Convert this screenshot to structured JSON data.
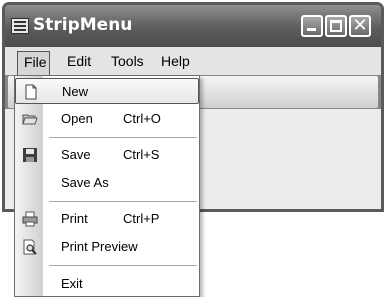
{
  "window": {
    "title": "StripMenu",
    "close_glyph": "✕"
  },
  "menubar": {
    "items": [
      {
        "label": "File"
      },
      {
        "label": "Edit"
      },
      {
        "label": "Tools"
      },
      {
        "label": "Help"
      }
    ]
  },
  "file_menu": {
    "items": [
      {
        "label": "New",
        "shortcut": "",
        "icon": "new-document-icon",
        "selected": true
      },
      {
        "label": "Open",
        "shortcut": "Ctrl+O",
        "icon": "open-folder-icon"
      },
      {
        "label": "Save",
        "shortcut": "Ctrl+S",
        "icon": "floppy-disk-icon"
      },
      {
        "label": "Save As",
        "shortcut": "",
        "icon": ""
      },
      {
        "label": "Print",
        "shortcut": "Ctrl+P",
        "icon": "printer-icon"
      },
      {
        "label": "Print Preview",
        "shortcut": "",
        "icon": "print-preview-icon"
      },
      {
        "label": "Exit",
        "shortcut": "",
        "icon": ""
      }
    ]
  }
}
